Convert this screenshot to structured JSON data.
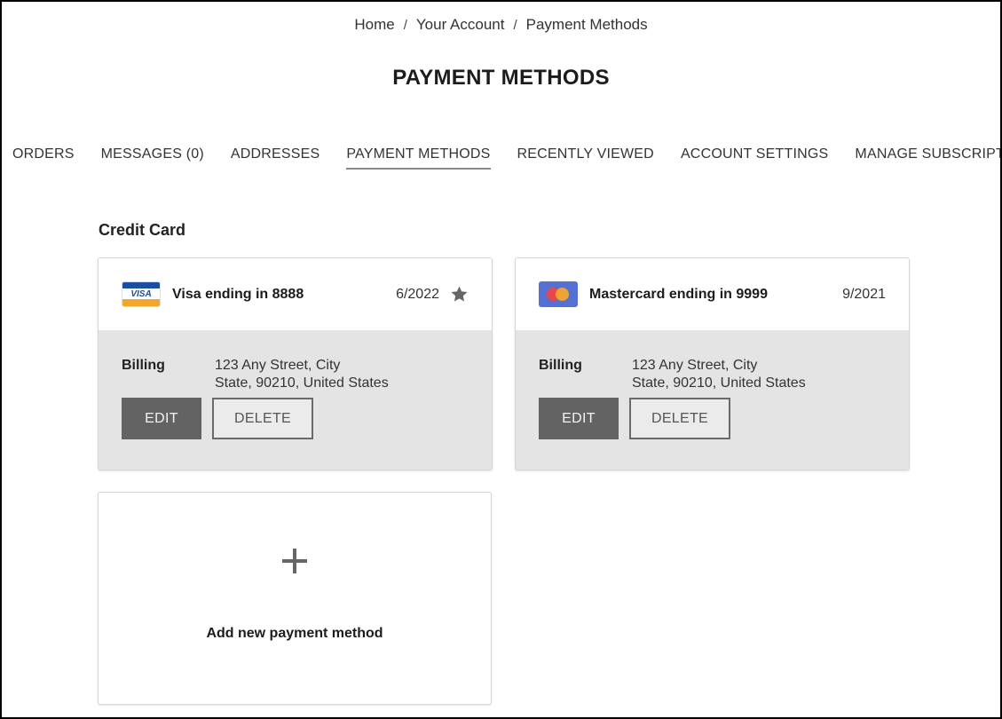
{
  "breadcrumb": {
    "items": [
      "Home",
      "Your Account",
      "Payment Methods"
    ],
    "separator": "/"
  },
  "page_title": "PAYMENT METHODS",
  "tabs": [
    {
      "label": "ORDERS",
      "active": false
    },
    {
      "label": "MESSAGES (0)",
      "active": false
    },
    {
      "label": "ADDRESSES",
      "active": false
    },
    {
      "label": "PAYMENT METHODS",
      "active": true
    },
    {
      "label": "RECENTLY VIEWED",
      "active": false
    },
    {
      "label": "ACCOUNT SETTINGS",
      "active": false
    },
    {
      "label": "MANAGE SUBSCRIPTIONS",
      "active": false
    }
  ],
  "section_title": "Credit Card",
  "cards": [
    {
      "brand": "visa",
      "brand_logo_text": "VISA",
      "name": "Visa ending in 8888",
      "expiry": "6/2022",
      "default": true,
      "default_icon": "star-icon",
      "billing_label": "Billing",
      "address_line1": "123 Any Street, City",
      "address_line2": "State, 90210, United States",
      "edit_label": "EDIT",
      "delete_label": "DELETE"
    },
    {
      "brand": "mastercard",
      "name": "Mastercard ending in 9999",
      "expiry": "9/2021",
      "default": false,
      "billing_label": "Billing",
      "address_line1": "123 Any Street, City",
      "address_line2": "State, 90210, United States",
      "edit_label": "EDIT",
      "delete_label": "DELETE"
    }
  ],
  "add_new": {
    "icon": "plus-icon",
    "label": "Add new payment method"
  },
  "colors": {
    "visa_blue": "#1a4fa0",
    "visa_gold": "#f3a62c",
    "mastercard_bg": "#5470d3",
    "mastercard_red": "#e8464b",
    "mastercard_orange": "#f3a62c",
    "edit_button": "#636363",
    "card_body_bg": "#e4e4e4",
    "star": "#666666"
  }
}
